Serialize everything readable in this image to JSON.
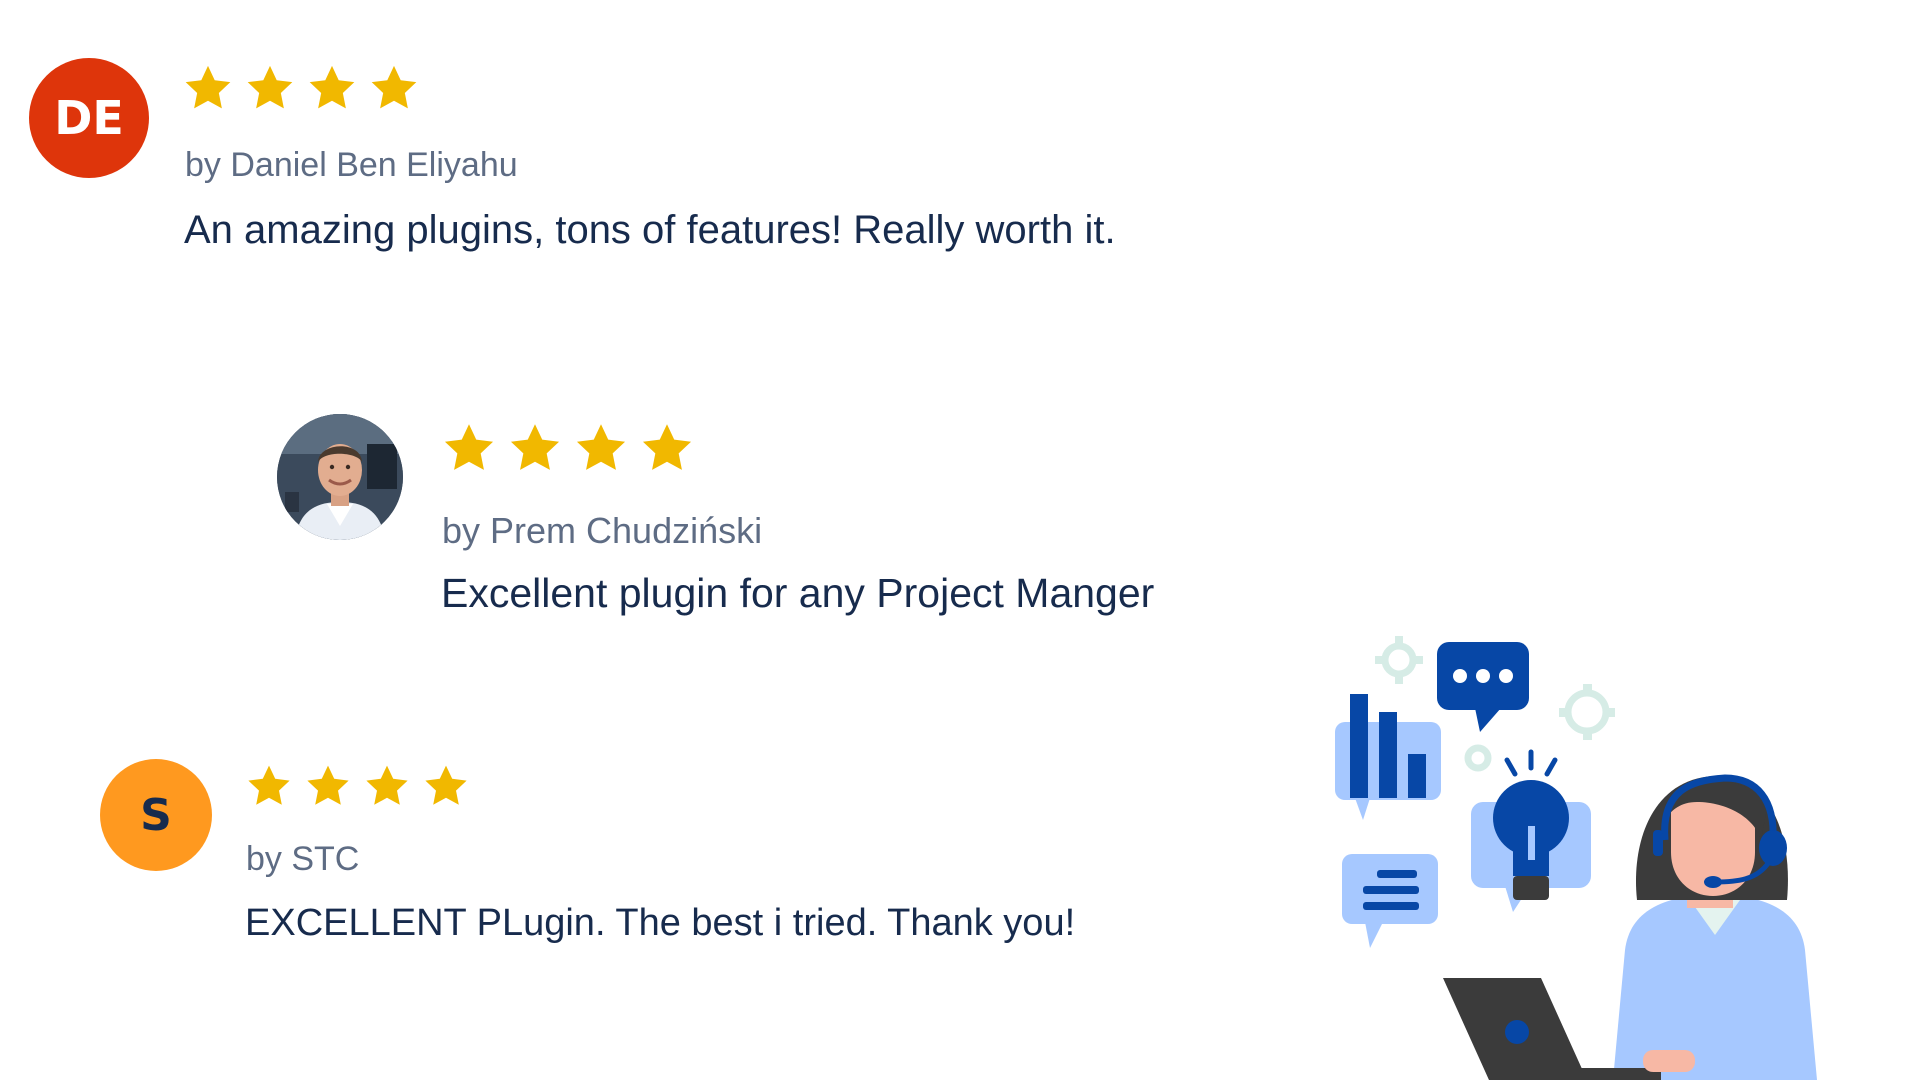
{
  "reviews": [
    {
      "avatar_initials": "DE",
      "avatar_color": "#de350b",
      "rating": 4,
      "author": "by Daniel Ben Eliyahu",
      "text": "An amazing plugins, tons of features! Really worth it."
    },
    {
      "avatar_initials": "",
      "avatar_color": "#4a5a6e",
      "rating": 4,
      "author": "by Prem Chudziński",
      "text": "Excellent plugin for any Project Manger"
    },
    {
      "avatar_initials": "S",
      "avatar_color": "#ff991f",
      "rating": 4,
      "author": "by STC",
      "text": "EXCELLENT PLugin. The best i tried. Thank you!"
    }
  ],
  "colors": {
    "star": "#f1b800",
    "text": "#172b4d",
    "byline": "#5e6c84",
    "accent_blue": "#0747a6",
    "light_blue": "#a6c8ff"
  },
  "icons": {
    "star": "star-icon",
    "illustration": "support-agent-illustration"
  }
}
